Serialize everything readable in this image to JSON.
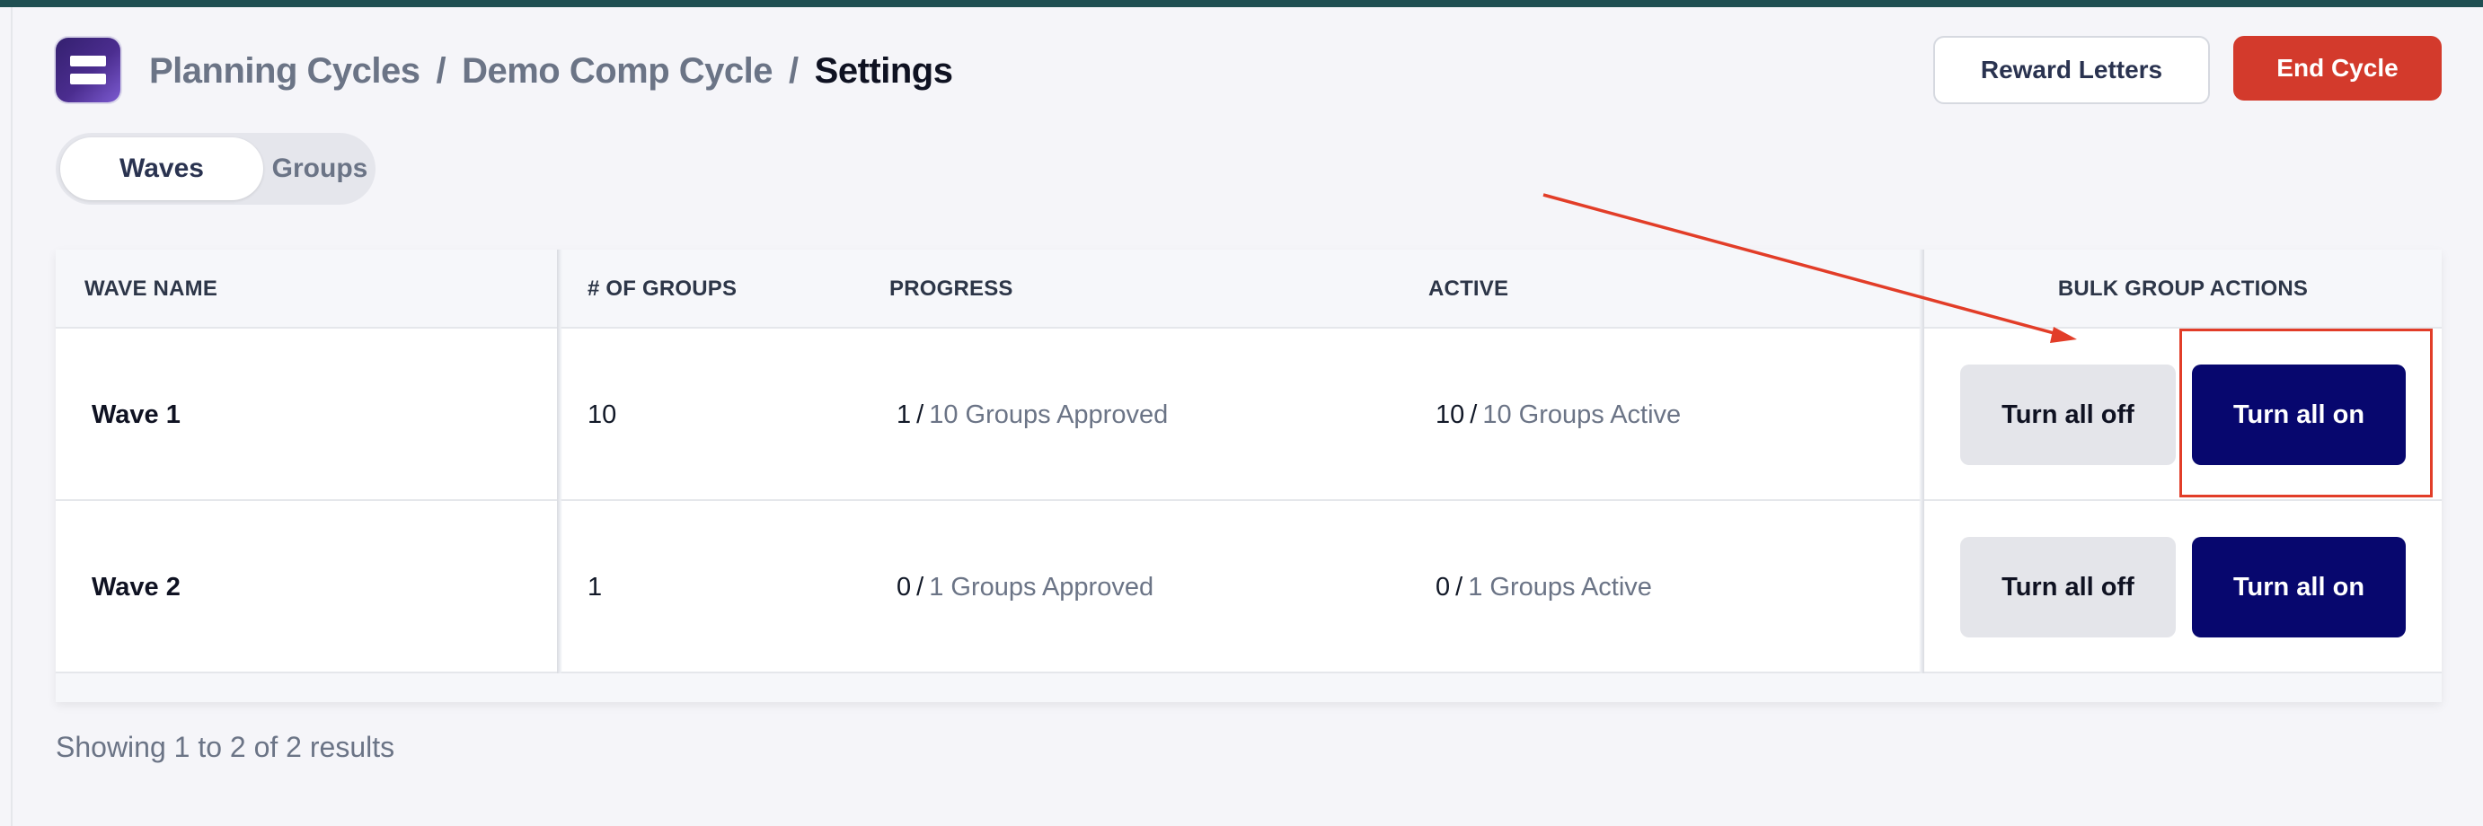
{
  "header": {
    "logo_icon": "app-logo-icon",
    "breadcrumb": [
      {
        "label": "Planning Cycles"
      },
      {
        "label": "Demo Comp Cycle"
      },
      {
        "label": "Settings"
      }
    ],
    "separator": "/",
    "reward_letters_label": "Reward Letters",
    "end_cycle_label": "End Cycle",
    "accent_colors": {
      "end_cycle": "#d33a2c",
      "primary_action": "#07076e",
      "annotation": "#e23d28"
    }
  },
  "tabs": [
    {
      "label": "Waves",
      "active": true
    },
    {
      "label": "Groups",
      "active": false
    }
  ],
  "table": {
    "columns": [
      "WAVE NAME",
      "# OF GROUPS",
      "PROGRESS",
      "ACTIVE",
      "BULK GROUP ACTIONS"
    ],
    "rows": [
      {
        "name": "Wave 1",
        "groups": "10",
        "progress_count": "1",
        "progress_text": "10 Groups Approved",
        "active_count": "10",
        "active_text": "10 Groups Active",
        "off_label": "Turn all off",
        "on_label": "Turn all on"
      },
      {
        "name": "Wave 2",
        "groups": "1",
        "progress_count": "0",
        "progress_text": "1 Groups Approved",
        "active_count": "0",
        "active_text": "1 Groups Active",
        "off_label": "Turn all off",
        "on_label": "Turn all on"
      }
    ]
  },
  "pagination": {
    "results_text": "Showing 1 to 2 of 2 results"
  }
}
